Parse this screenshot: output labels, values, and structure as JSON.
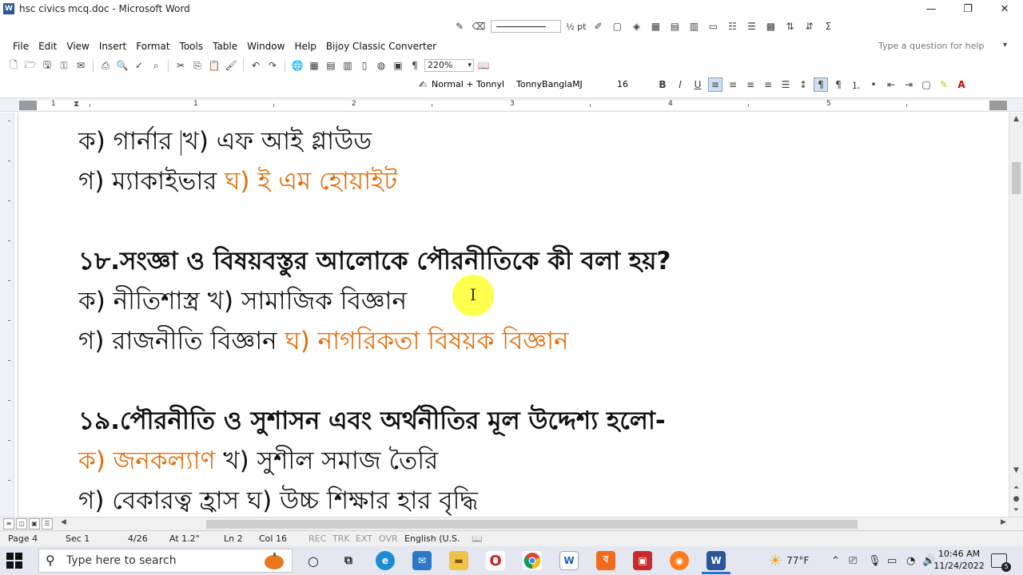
{
  "window": {
    "title": "hsc civics mcq.doc - Microsoft Word",
    "minimize": "—",
    "restore": "❐",
    "close": "✕"
  },
  "drawing_toolbar": {
    "line_weight": "½ pt"
  },
  "menu": {
    "items": [
      "File",
      "Edit",
      "View",
      "Insert",
      "Format",
      "Tools",
      "Table",
      "Window",
      "Help",
      "Bijoy Classic Converter"
    ],
    "help_placeholder": "Type a question for help"
  },
  "standard_toolbar": {
    "zoom": "220%"
  },
  "formatting_toolbar": {
    "style": "Normal + Tonnyl",
    "font": "TonnyBanglaMJ",
    "size": "16",
    "bold": "B",
    "italic": "I",
    "underline": "U"
  },
  "ruler": {
    "numbers": [
      "1",
      "1",
      "2",
      "3",
      "4",
      "5"
    ]
  },
  "document": {
    "lines": [
      {
        "parts": [
          {
            "t": "ক) গার্নার",
            "c": "black"
          },
          {
            "t": "খ) এফ আই গ্লাউড",
            "c": "black"
          }
        ]
      },
      {
        "parts": [
          {
            "t": "গ) ম্যাকাইভার ",
            "c": "black"
          },
          {
            "t": "ঘ) ই এম হোয়াইট",
            "c": "orange"
          }
        ]
      },
      {
        "parts": [
          {
            "t": "১৮.সংজ্ঞা ও বিষয়বস্তুর আলোকে পৌরনীতিকে কী বলা হয়?",
            "c": "black"
          }
        ]
      },
      {
        "parts": [
          {
            "t": "ক) নীতিশাস্ত্র খ) সামাজিক বিজ্ঞান",
            "c": "black"
          }
        ]
      },
      {
        "parts": [
          {
            "t": "গ) রাজনীতি বিজ্ঞান ",
            "c": "black"
          },
          {
            "t": "ঘ) নাগরিকতা বিষয়ক বিজ্ঞান",
            "c": "orange"
          }
        ]
      },
      {
        "parts": [
          {
            "t": "১৯.পৌরনীতি ও সুশাসন এবং অর্থনীতির মূল উদ্দেশ্য হলো-",
            "c": "black"
          }
        ]
      },
      {
        "parts": [
          {
            "t": "ক) জনকল্যাণ ",
            "c": "orange"
          },
          {
            "t": "খ) সুশীল সমাজ তৈরি",
            "c": "black"
          }
        ]
      },
      {
        "parts": [
          {
            "t": "গ) বেকারত্ব হ্রাস ঘ) উচ্চ শিক্ষার হার বৃদ্ধি",
            "c": "black"
          }
        ]
      }
    ]
  },
  "status": {
    "page": "Page 4",
    "sec": "Sec 1",
    "pages": "4/26",
    "at": "At 1.2\"",
    "ln": "Ln 2",
    "col": "Col 16",
    "rec": "REC",
    "trk": "TRK",
    "ext": "EXT",
    "ovr": "OVR",
    "language": "English (U.S."
  },
  "taskbar": {
    "search_placeholder": "Type here to search",
    "weather": "77°F",
    "time": "10:46 AM",
    "date": "11/24/2022",
    "notification_count": "5"
  },
  "colors": {
    "answer": "#e46c0a",
    "word_blue": "#2b579a"
  }
}
